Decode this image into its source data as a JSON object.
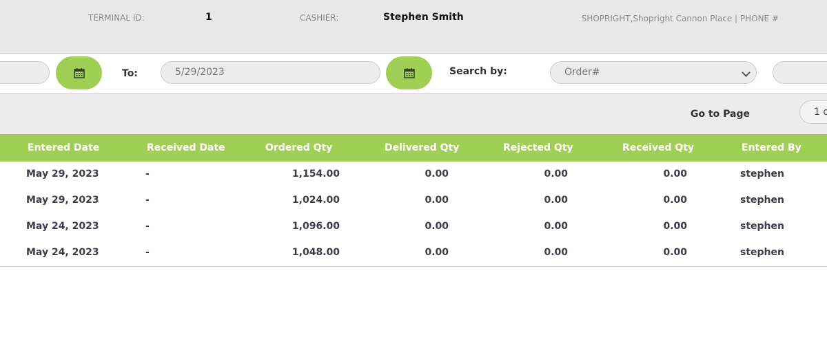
{
  "header": {
    "terminal_label": "TERMINAL ID:",
    "terminal_value": "1",
    "cashier_label": "CASHIER:",
    "cashier_value": "Stephen Smith",
    "store_info": "SHOPRIGHT,Shopright Cannon Place | PHONE #"
  },
  "filters": {
    "from_value": "",
    "to_label": "To:",
    "to_value": "5/29/2023",
    "search_label": "Search by:",
    "search_select_value": "Order#",
    "search_input_value": ""
  },
  "pager": {
    "goto_label": "Go to Page",
    "page_value": "1 o"
  },
  "table": {
    "columns": [
      "Entered Date",
      "Received Date",
      "Ordered Qty",
      "Delivered Qty",
      "Rejected Qty",
      "Received Qty",
      "Entered By"
    ],
    "rows": [
      [
        "May 29, 2023",
        "-",
        "1,154.00",
        "0.00",
        "0.00",
        "0.00",
        "stephen"
      ],
      [
        "May 29, 2023",
        "-",
        "1,024.00",
        "0.00",
        "0.00",
        "0.00",
        "stephen"
      ],
      [
        "May 24, 2023",
        "-",
        "1,096.00",
        "0.00",
        "0.00",
        "0.00",
        "stephen"
      ],
      [
        "May 24, 2023",
        "-",
        "1,048.00",
        "0.00",
        "0.00",
        "0.00",
        "stephen"
      ]
    ]
  },
  "colors": {
    "accent": "#a0cf55",
    "header_bg": "#e9e9e9"
  }
}
